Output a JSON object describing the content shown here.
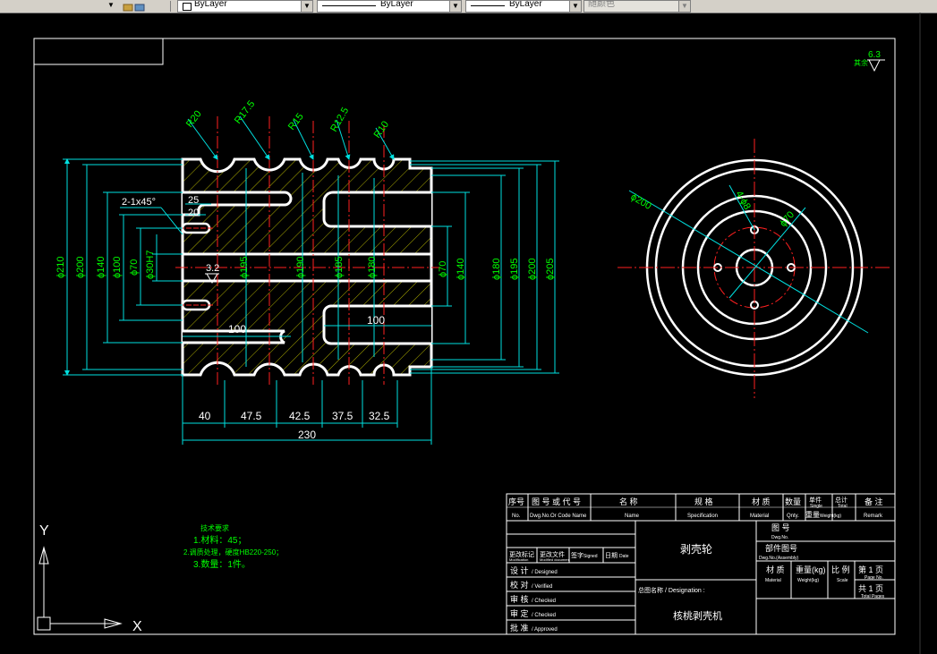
{
  "toolbar": {
    "layer_dropdown": "ByLayer",
    "linetype_dropdown": "ByLayer",
    "lineweight_dropdown": "ByLayer",
    "plotstyle_dropdown": "随颜色"
  },
  "drawing": {
    "roughness": "6.3",
    "roughness_prefix": "其余",
    "front_view_dims": {
      "radii": [
        "R20",
        "R17.5",
        "R15",
        "R12.5",
        "R10"
      ],
      "chamfer": "2-1x45°",
      "small_25": "25",
      "small_20": "20",
      "surface_32": "3.2",
      "left_diams": [
        "ϕ210",
        "ϕ200",
        "ϕ140",
        "ϕ100",
        "ϕ70",
        "ϕ30H7"
      ],
      "center_diams": [
        "ϕ195",
        "ϕ190",
        "ϕ185",
        "ϕ180"
      ],
      "right_diams": [
        "ϕ70",
        "ϕ140",
        "ϕ180",
        "ϕ195",
        "ϕ200",
        "ϕ205"
      ],
      "len_left": "100",
      "len_right": "100",
      "bottom_segments": [
        "40",
        "47.5",
        "42.5",
        "37.5",
        "32.5"
      ],
      "total_length": "230"
    },
    "side_view_dims": {
      "outer": "ϕ200",
      "hole": "4-ϕ8",
      "pcd": "ϕ70"
    },
    "tech_req": {
      "title": "技术要求",
      "items": [
        "1.材料：45；",
        "2.调质处理，硬度HB220-250；",
        "3.数量：1件。"
      ]
    },
    "ucs": {
      "y": "Y",
      "x": "X"
    }
  },
  "title_block": {
    "header": [
      {
        "cn": "序号",
        "en": "No."
      },
      {
        "cn": "图 号 或 代 号",
        "en": "Dwg.No.Or Code Name"
      },
      {
        "cn": "名  称",
        "en": "Name"
      },
      {
        "cn": "规  格",
        "en": "Specification"
      },
      {
        "cn": "材 质",
        "en": "Material"
      },
      {
        "cn": "数量",
        "en": "Qnty."
      },
      {
        "cn": "单件",
        "en": "Single"
      },
      {
        "cn": "总计",
        "en": "Total"
      },
      {
        "cn": "备 注",
        "en": "Remark"
      }
    ],
    "weight_label": "重量",
    "weight_en": "Weight(kg)",
    "rev_headers": [
      {
        "cn": "更改标记",
        "en": "Modification"
      },
      {
        "cn": "更改文件",
        "en": "Modified document"
      },
      {
        "cn": "签字",
        "en": "Signed"
      },
      {
        "cn": "日期",
        "en": "Date"
      }
    ],
    "roles": [
      {
        "cn": "设 计",
        "en": "/ Designed"
      },
      {
        "cn": "校 对",
        "en": "/ Verified"
      },
      {
        "cn": "审 核",
        "en": "/ Checked"
      },
      {
        "cn": "审 定",
        "en": "/ Checked"
      },
      {
        "cn": "批 准",
        "en": "/ Approved"
      }
    ],
    "part_name": "剥壳轮",
    "designation_label": "总图名称 / Designation :",
    "assembly_name": "核桃剥壳机",
    "dwg_no": {
      "cn": "图 号",
      "en": "Dwg.No."
    },
    "asm_dwg_no": {
      "cn": "部件图号",
      "en": "Dwg.No.(Assembly)"
    },
    "material": {
      "cn": "材 质",
      "en": "Material"
    },
    "weight": {
      "cn": "重量(kg)",
      "en": "Weight(kg)"
    },
    "scale": {
      "cn": "比 例",
      "en": "Scale"
    },
    "page_no": {
      "cn": "第  1 页",
      "en": "Page No."
    },
    "total_pages": {
      "cn": "共  1 页",
      "en": "Total Pages"
    }
  }
}
